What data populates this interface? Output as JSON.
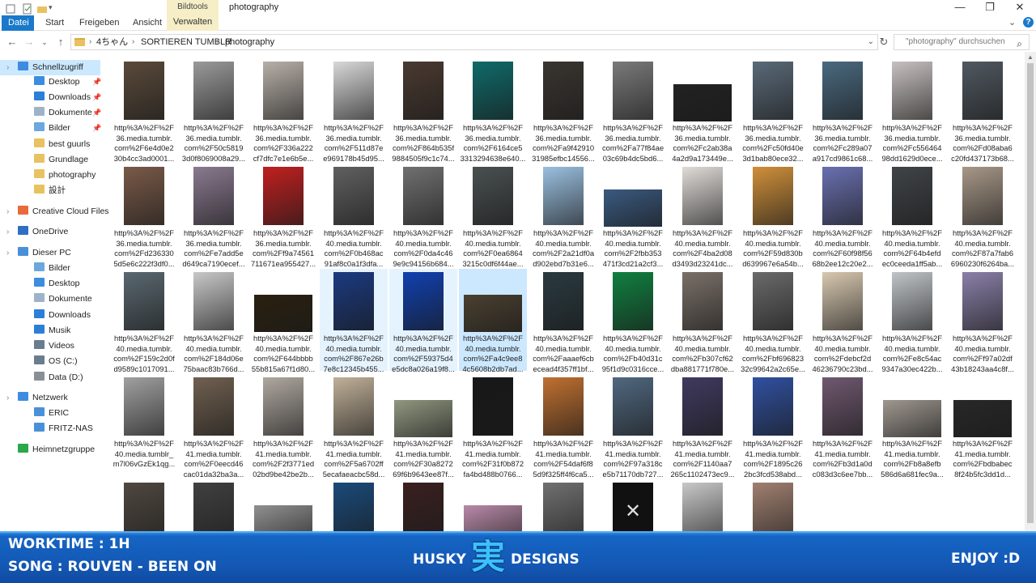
{
  "window": {
    "title": "photography",
    "context_tab_header": "Bildtools",
    "tabs": [
      "Datei",
      "Start",
      "Freigeben",
      "Ansicht",
      "Verwalten"
    ],
    "active_tab": "Datei",
    "controls": {
      "minimize": "—",
      "maximize": "❐",
      "close": "✕"
    },
    "help_icon": "?"
  },
  "address": {
    "breadcrumbs": [
      "4ちゃん",
      "SORTIEREN TUMBLR",
      "photography"
    ],
    "search_placeholder": "\"photography\" durchsuchen"
  },
  "sidebar": {
    "items": [
      {
        "label": "Schnellzugriff",
        "icon": "star-icon",
        "color": "#3d8ce0",
        "pinned": false,
        "selected": true
      },
      {
        "label": "Desktop",
        "icon": "desktop-icon",
        "color": "#3d8ce0",
        "pinned": true
      },
      {
        "label": "Downloads",
        "icon": "download-icon",
        "color": "#2b7fd8",
        "pinned": true
      },
      {
        "label": "Dokumente",
        "icon": "documents-icon",
        "color": "#9fb3c8",
        "pinned": true
      },
      {
        "label": "Bilder",
        "icon": "pictures-icon",
        "color": "#6aa8dd",
        "pinned": true
      },
      {
        "label": "best guurls",
        "icon": "folder-icon",
        "color": "#e8c260",
        "pinned": false
      },
      {
        "label": "Grundlage",
        "icon": "folder-icon",
        "color": "#e8c260",
        "pinned": false
      },
      {
        "label": "photography",
        "icon": "folder-icon",
        "color": "#e8c260",
        "pinned": false
      },
      {
        "label": "設計",
        "icon": "folder-icon",
        "color": "#e8c260",
        "pinned": false
      },
      {
        "label": "Creative Cloud Files",
        "icon": "creative-cloud-icon",
        "color": "#e96a3a",
        "pinned": false
      },
      {
        "label": "OneDrive",
        "icon": "onedrive-icon",
        "color": "#2f6fc0",
        "pinned": false
      },
      {
        "label": "Dieser PC",
        "icon": "computer-icon",
        "color": "#4a90d9",
        "pinned": false
      },
      {
        "label": "Bilder",
        "icon": "pictures-icon",
        "color": "#6aa8dd",
        "pinned": false
      },
      {
        "label": "Desktop",
        "icon": "desktop-icon",
        "color": "#3d8ce0",
        "pinned": false
      },
      {
        "label": "Dokumente",
        "icon": "documents-icon",
        "color": "#9fb3c8",
        "pinned": false
      },
      {
        "label": "Downloads",
        "icon": "download-icon",
        "color": "#2b7fd8",
        "pinned": false
      },
      {
        "label": "Musik",
        "icon": "music-icon",
        "color": "#2b7fd8",
        "pinned": false
      },
      {
        "label": "Videos",
        "icon": "video-icon",
        "color": "#6b7c8f",
        "pinned": false
      },
      {
        "label": "OS (C:)",
        "icon": "drive-icon",
        "color": "#6b7c8f",
        "pinned": false
      },
      {
        "label": "Data (D:)",
        "icon": "drive-icon",
        "color": "#8a8f96",
        "pinned": false
      },
      {
        "label": "Netzwerk",
        "icon": "network-icon",
        "color": "#3d8ce0",
        "pinned": false
      },
      {
        "label": "ERIC",
        "icon": "network-pc-icon",
        "color": "#4a90d9",
        "pinned": false
      },
      {
        "label": "FRITZ-NAS",
        "icon": "network-pc-icon",
        "color": "#4a90d9",
        "pinned": false
      },
      {
        "label": "Heimnetzgruppe",
        "icon": "homegroup-icon",
        "color": "#2aa84a",
        "pinned": false
      }
    ]
  },
  "files": [
    {
      "name": "http%3A%2F%2F\n36.media.tumblr.\ncom%2F6e4d0e2\n30b4cc3ad0001...",
      "color": "#5a4a3a"
    },
    {
      "name": "http%3A%2F%2F\n36.media.tumblr.\ncom%2F50c5819\n3d0f8069008a29...",
      "color": "#9a9a9a"
    },
    {
      "name": "http%3A%2F%2F\n36.media.tumblr.\ncom%2F336a222\ncf7dfc7e1e6b5e...",
      "color": "#b8b0a8"
    },
    {
      "name": "http%3A%2F%2F\n36.media.tumblr.\ncom%2F511d87e\ne969178b45d95...",
      "color": "#d8d8d8"
    },
    {
      "name": "http%3A%2F%2F\n36.media.tumblr.\ncom%2F864b535f\n9884505f9c1c74...",
      "color": "#4a3a30"
    },
    {
      "name": "http%3A%2F%2F\n36.media.tumblr.\ncom%2F6164ce5\n3313294638e640...",
      "color": "#0f6a6a"
    },
    {
      "name": "http%3A%2F%2F\n36.media.tumblr.\ncom%2Fa9f42910\n31985efbc14556...",
      "color": "#3a3530"
    },
    {
      "name": "http%3A%2F%2F\n36.media.tumblr.\ncom%2Fa77f84ae\n03c69b4dc5bd6...",
      "color": "#7a7a7a"
    },
    {
      "name": "http%3A%2F%2F\n36.media.tumblr.\ncom%2Fc2ab38a\n4a2d9a173449e...",
      "color": "#222222"
    },
    {
      "name": "http%3A%2F%2F\n36.media.tumblr.\ncom%2Fc50fd40e\n3d1bab80ece32...",
      "color": "#5a6a78"
    },
    {
      "name": "http%3A%2F%2F\n36.media.tumblr.\ncom%2Fc289a07\na917cd9861c68...",
      "color": "#4a6a80"
    },
    {
      "name": "http%3A%2F%2F\n36.media.tumblr.\ncom%2Fc556464\n98dd1629d0ece...",
      "color": "#c8c0c0"
    },
    {
      "name": "http%3A%2F%2F\n36.media.tumblr.\ncom%2Fd08aba6\nc20fd437173b68...",
      "color": "#505860"
    },
    {
      "name": "http%3A%2F%2F\n36.media.tumblr.\ncom%2Fd236330\n5d5e6c222f3df0...",
      "color": "#7a5a48"
    },
    {
      "name": "http%3A%2F%2F\n36.media.tumblr.\ncom%2Fe7add5e\nd649ca7190ecef...",
      "color": "#8a7a90"
    },
    {
      "name": "http%3A%2F%2F\n36.media.tumblr.\ncom%2Ff9a74561\n711671ea955427...",
      "color": "#c02020"
    },
    {
      "name": "http%3A%2F%2F\n40.media.tumblr.\ncom%2F0b468ac\n91af8c0a1f3dfa...",
      "color": "#606060"
    },
    {
      "name": "http%3A%2F%2F\n40.media.tumblr.\ncom%2F0da4c46\n9e9c94156b684...",
      "color": "#707070"
    },
    {
      "name": "http%3A%2F%2F\n40.media.tumblr.\ncom%2F0ea6864\n3215c0df6f44ae...",
      "color": "#4a5050"
    },
    {
      "name": "http%3A%2F%2F\n40.media.tumblr.\ncom%2F2a21df0a\nd902ebd7b31e6...",
      "color": "#9ac0e0"
    },
    {
      "name": "http%3A%2F%2F\n40.media.tumblr.\ncom%2F2fbb353\n471f3cd21a2cf3...",
      "color": "#3a5a80"
    },
    {
      "name": "http%3A%2F%2F\n40.media.tumblr.\ncom%2F4ba2d08\nd3493d23241dc...",
      "color": "#e0dcd8"
    },
    {
      "name": "http%3A%2F%2F\n40.media.tumblr.\ncom%2F59d830b\nd639967e6a54b...",
      "color": "#d0903a"
    },
    {
      "name": "http%3A%2F%2F\n40.media.tumblr.\ncom%2F60f98f56\n68b2ee12c20e2...",
      "color": "#6a70b0"
    },
    {
      "name": "http%3A%2F%2F\n40.media.tumblr.\ncom%2F64b4efd\nec0ceeda1ff5ab...",
      "color": "#404448"
    },
    {
      "name": "http%3A%2F%2F\n40.media.tumblr.\ncom%2F87a7fab6\n6960230f6264ba...",
      "color": "#a89888"
    },
    {
      "name": "http%3A%2F%2F\n40.media.tumblr.\ncom%2F159c2d0f\nd9589c1017091...",
      "color": "#5a6870"
    },
    {
      "name": "http%3A%2F%2F\n40.media.tumblr.\ncom%2F184d06e\n75baac83b766d...",
      "color": "#c8c8c8"
    },
    {
      "name": "http%3A%2F%2F\n40.media.tumblr.\ncom%2F644bbbb\n55b815a67f1d80...",
      "color": "#2a2010"
    },
    {
      "name": "http%3A%2F%2F\n40.media.tumblr.\ncom%2F867e26b\n7e8c12345b455...",
      "color": "#1a3a80"
    },
    {
      "name": "http%3A%2F%2F\n40.media.tumblr.\ncom%2F59375d4\ne5dc8a026a19f8...",
      "color": "#1040b0"
    },
    {
      "name": "http%3A%2F%2F\n40.media.tumblr.\ncom%2Fa4c9ee8\n4c5608b2db7ad...",
      "color": "#4a4030"
    },
    {
      "name": "http%3A%2F%2F\n40.media.tumblr.\ncom%2Faaaef6cb\necead4f357ff1bf...",
      "color": "#2a3a40"
    },
    {
      "name": "http%3A%2F%2F\n40.media.tumblr.\ncom%2Fb40d31c\n95f1d9c0316cce...",
      "color": "#108040"
    },
    {
      "name": "http%3A%2F%2F\n40.media.tumblr.\ncom%2Fb307cf62\ndba881771f780e...",
      "color": "#7a7068"
    },
    {
      "name": "http%3A%2F%2F\n40.media.tumblr.\ncom%2Fbf696823\n32c99642a2c65e...",
      "color": "#6a6a6a"
    },
    {
      "name": "http%3A%2F%2F\n40.media.tumblr.\ncom%2Fdebcf2d\n46236790c23bd...",
      "color": "#d8c8b0"
    },
    {
      "name": "http%3A%2F%2F\n40.media.tumblr.\ncom%2Fe8c54ac\n9347a30ec422b...",
      "color": "#c0c4c8"
    },
    {
      "name": "http%3A%2F%2F\n40.media.tumblr.\ncom%2Ff97a02df\n43b18243aa4c8f...",
      "color": "#8a80a8"
    },
    {
      "name": "http%3A%2F%2F\n40.media.tumblr_\nm7l06vGzEk1qg...",
      "color": "#a0a0a0"
    },
    {
      "name": "http%3A%2F%2F\n41.media.tumblr.\ncom%2F0eecd46\ncac01da32ba3a...",
      "color": "#706050"
    },
    {
      "name": "http%3A%2F%2F\n41.media.tumblr.\ncom%2F2f3771ed\n02bd9be42be2b...",
      "color": "#b0a8a0"
    },
    {
      "name": "http%3A%2F%2F\n41.media.tumblr.\ncom%2F5a6702ff\n5ecafaeacbc58d...",
      "color": "#c0b098"
    },
    {
      "name": "http%3A%2F%2F\n41.media.tumblr.\ncom%2F30a8272\n69f6b9643ee87f...",
      "color": "#909880"
    },
    {
      "name": "http%3A%2F%2F\n41.media.tumblr.\ncom%2F31f0b872\nfa4bd488b0766...",
      "color": "#181818"
    },
    {
      "name": "http%3A%2F%2F\n41.media.tumblr.\ncom%2F54daf6f8\n5d9f325ff4f6ca5...",
      "color": "#c07030"
    },
    {
      "name": "http%3A%2F%2F\n41.media.tumblr.\ncom%2F97a318c\ne5b71170db727...",
      "color": "#506880"
    },
    {
      "name": "http%3A%2F%2F\n41.media.tumblr.\ncom%2F1140aa7\n265c1102473ec9...",
      "color": "#403a60"
    },
    {
      "name": "http%3A%2F%2F\n41.media.tumblr.\ncom%2F1895c26\n2bc3fcd538abd...",
      "color": "#3050a0"
    },
    {
      "name": "http%3A%2F%2F\n41.media.tumblr.\ncom%2Fb3d1a0d\nc083d3c6ee7bb...",
      "color": "#705870"
    },
    {
      "name": "http%3A%2F%2F\n41.media.tumblr.\ncom%2Fb8a8efb\n586d6a681fec9a...",
      "color": "#a09890"
    },
    {
      "name": "http%3A%2F%2F\n41.media.tumblr.\ncom%2Fbdbabec\n8f24b5fc3dd1d...",
      "color": "#282828"
    },
    {
      "name": "",
      "color": "#504840"
    },
    {
      "name": "",
      "color": "#404040"
    },
    {
      "name": "",
      "color": "#909090"
    },
    {
      "name": "",
      "color": "#1a4a7a"
    },
    {
      "name": "",
      "color": "#3a2020"
    },
    {
      "name": "",
      "color": "#b88aa8"
    },
    {
      "name": "",
      "color": "#707070"
    },
    {
      "name": "",
      "color": "#101010"
    },
    {
      "name": "",
      "color": "#c8c8c8"
    },
    {
      "name": "",
      "color": "#a08070"
    }
  ],
  "thumb_overlay_x": "✕",
  "overlay": {
    "worktime": "WORKTIME : 1H",
    "song": "SONG : ROUVEN - BEEN ON",
    "brand_left": "HUSKY",
    "brand_kanji": "実",
    "brand_right": "DESIGNS",
    "enjoy": "ENJOY :D",
    "colors": {
      "banner": "#1458b4",
      "kanji": "#3cc0ff"
    }
  }
}
